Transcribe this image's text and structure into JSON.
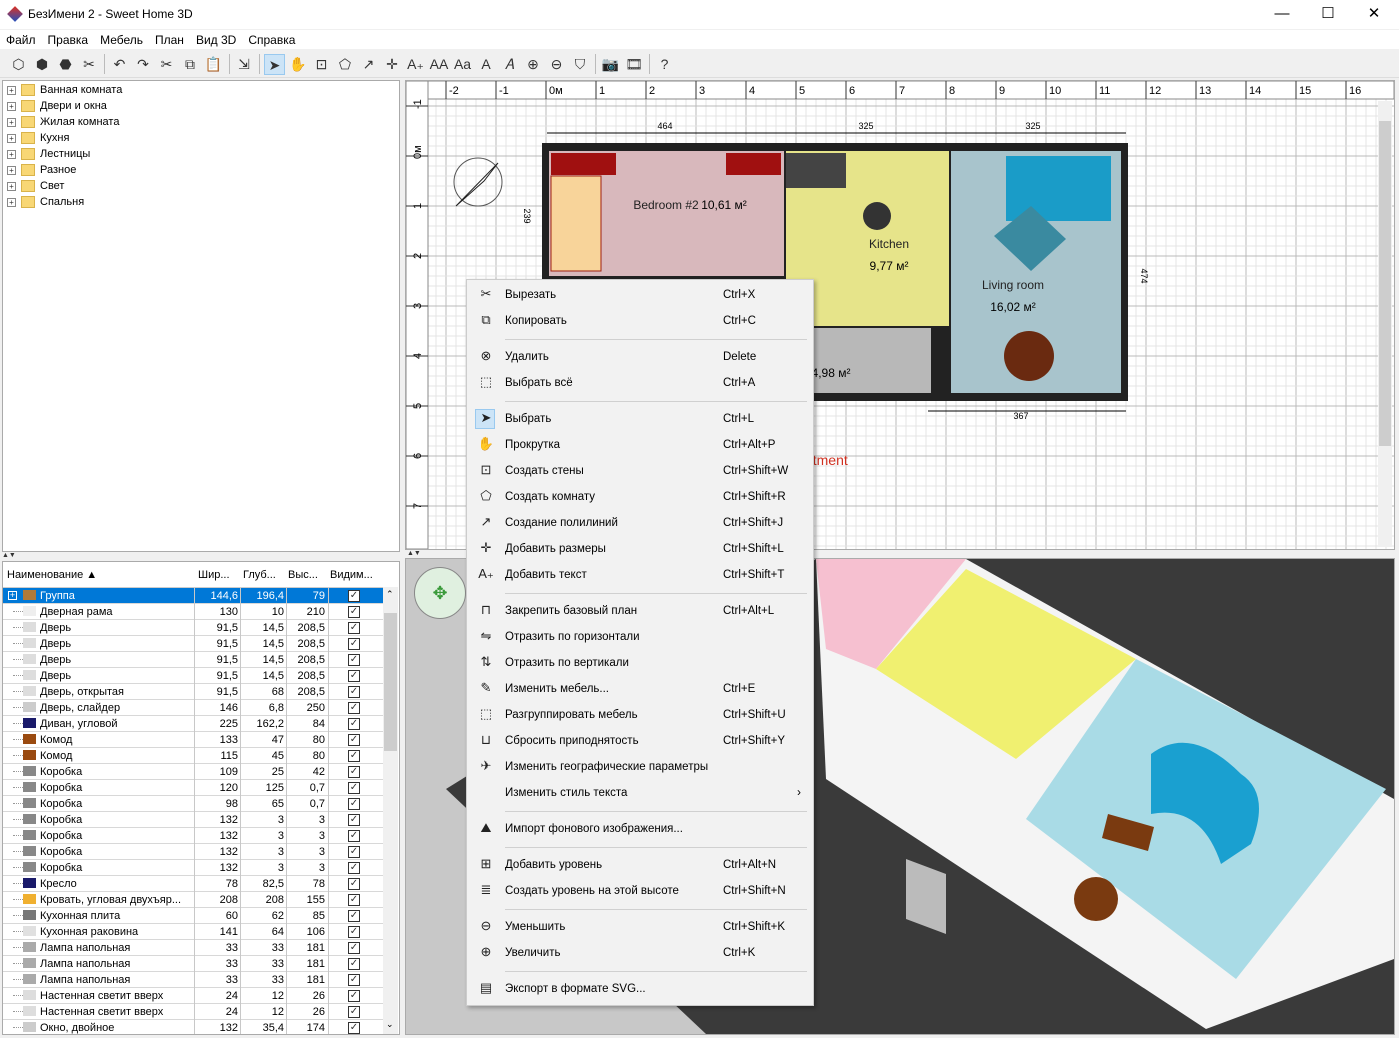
{
  "window": {
    "title": "БезИмени 2 - Sweet Home 3D",
    "minimize": "—",
    "maximize": "☐",
    "close": "✕"
  },
  "menu": [
    "Файл",
    "Правка",
    "Мебель",
    "План",
    "Вид 3D",
    "Справка"
  ],
  "toolbar": [
    {
      "name": "new-home-icon",
      "g": "⬡"
    },
    {
      "name": "open-icon",
      "g": "⬢"
    },
    {
      "name": "save-icon",
      "g": "⬣"
    },
    {
      "name": "preferences-icon",
      "g": "✂"
    },
    {
      "sep": true
    },
    {
      "name": "undo-icon",
      "g": "↶"
    },
    {
      "name": "redo-icon",
      "g": "↷"
    },
    {
      "name": "cut-icon",
      "g": "✂"
    },
    {
      "name": "copy-icon",
      "g": "⧉"
    },
    {
      "name": "paste-icon",
      "g": "📋"
    },
    {
      "sep": true
    },
    {
      "name": "add-furniture-icon",
      "g": "⇲"
    },
    {
      "sep": true
    },
    {
      "name": "select-mode-icon",
      "g": "➤",
      "on": true
    },
    {
      "name": "pan-mode-icon",
      "g": "✋"
    },
    {
      "name": "create-walls-icon",
      "g": "⊡"
    },
    {
      "name": "create-rooms-icon",
      "g": "⬠"
    },
    {
      "name": "create-polylines-icon",
      "g": "↗"
    },
    {
      "name": "create-dimensions-icon",
      "g": "✛"
    },
    {
      "name": "add-text-icon",
      "g": "A₊"
    },
    {
      "name": "increase-text-icon",
      "g": "AA"
    },
    {
      "name": "decrease-text-icon",
      "g": "Aa"
    },
    {
      "name": "bold-text-icon",
      "g": "A"
    },
    {
      "name": "italic-text-icon",
      "g": "𝐴"
    },
    {
      "name": "zoom-in-icon",
      "g": "⊕"
    },
    {
      "name": "zoom-out-icon",
      "g": "⊖"
    },
    {
      "name": "create-photo-icon",
      "g": "⛉"
    },
    {
      "sep": true
    },
    {
      "name": "photo-icon",
      "g": "📷"
    },
    {
      "name": "video-icon",
      "g": "🎞"
    },
    {
      "sep": true
    },
    {
      "name": "help-icon",
      "g": "?"
    }
  ],
  "catalog": [
    "Ванная комната",
    "Двери и окна",
    "Жилая комната",
    "Кухня",
    "Лестницы",
    "Разное",
    "Свет",
    "Спальня"
  ],
  "furniture": {
    "columns": [
      "Наименование ▲",
      "Шир...",
      "Глуб...",
      "Выс...",
      "Видим..."
    ],
    "rows": [
      [
        "Группа",
        "144,6",
        "196,4",
        "79",
        "#b07a3a"
      ],
      [
        "Дверная рама",
        "130",
        "10",
        "210",
        "#eee"
      ],
      [
        "Дверь",
        "91,5",
        "14,5",
        "208,5",
        "#ddd"
      ],
      [
        "Дверь",
        "91,5",
        "14,5",
        "208,5",
        "#ddd"
      ],
      [
        "Дверь",
        "91,5",
        "14,5",
        "208,5",
        "#ddd"
      ],
      [
        "Дверь",
        "91,5",
        "14,5",
        "208,5",
        "#ddd"
      ],
      [
        "Дверь, открытая",
        "91,5",
        "68",
        "208,5",
        "#ddd"
      ],
      [
        "Дверь, слайдер",
        "146",
        "6,8",
        "250",
        "#ccc"
      ],
      [
        "Диван, угловой",
        "225",
        "162,2",
        "84",
        "#1a1a6a"
      ],
      [
        "Комод",
        "133",
        "47",
        "80",
        "#9a4a10"
      ],
      [
        "Комод",
        "115",
        "45",
        "80",
        "#9a4a10"
      ],
      [
        "Коробка",
        "109",
        "25",
        "42",
        "#888"
      ],
      [
        "Коробка",
        "120",
        "125",
        "0,7",
        "#888"
      ],
      [
        "Коробка",
        "98",
        "65",
        "0,7",
        "#888"
      ],
      [
        "Коробка",
        "132",
        "3",
        "3",
        "#888"
      ],
      [
        "Коробка",
        "132",
        "3",
        "3",
        "#888"
      ],
      [
        "Коробка",
        "132",
        "3",
        "3",
        "#888"
      ],
      [
        "Коробка",
        "132",
        "3",
        "3",
        "#888"
      ],
      [
        "Кресло",
        "78",
        "82,5",
        "78",
        "#1a1a6a"
      ],
      [
        "Кровать, угловая двухъяр...",
        "208",
        "208",
        "155",
        "#f0b030"
      ],
      [
        "Кухонная плита",
        "60",
        "62",
        "85",
        "#777"
      ],
      [
        "Кухонная раковина",
        "141",
        "64",
        "106",
        "#e0e0e0"
      ],
      [
        "Лампа напольная",
        "33",
        "33",
        "181",
        "#aaa"
      ],
      [
        "Лампа напольная",
        "33",
        "33",
        "181",
        "#aaa"
      ],
      [
        "Лампа напольная",
        "33",
        "33",
        "181",
        "#aaa"
      ],
      [
        "Настенная светит вверх",
        "24",
        "12",
        "26",
        "#ddd"
      ],
      [
        "Настенная светит вверх",
        "24",
        "12",
        "26",
        "#ddd"
      ],
      [
        "Окно, двойное",
        "132",
        "35,4",
        "174",
        "#ccc"
      ]
    ],
    "visible_check": "✓"
  },
  "plan": {
    "ruler_x": [
      "-2",
      "-1",
      "0м",
      "1",
      "2",
      "3",
      "4",
      "5",
      "6",
      "7",
      "8",
      "9",
      "10",
      "11",
      "12",
      "13",
      "14",
      "15",
      "16"
    ],
    "ruler_y": [
      "-1",
      "0м",
      "1",
      "2",
      "3",
      "4",
      "5",
      "6",
      "7"
    ],
    "dims": [
      "464",
      "325",
      "325",
      "239",
      "474",
      "367"
    ],
    "rooms": [
      {
        "name": "Bedroom #2",
        "area": "10,61 м²"
      },
      {
        "name": "Kitchen",
        "area": "9,77 м²"
      },
      {
        "name": "Living room",
        "area": "16,02 м²"
      },
      {
        "name": "",
        "area": "4,98 м²"
      }
    ],
    "label": "Two bedroom apartment",
    "label_color": "#d03020"
  },
  "context_menu": [
    {
      "icon": "cut-icon",
      "g": "✂",
      "label": "Вырезать",
      "shortcut": "Ctrl+X"
    },
    {
      "icon": "copy-icon",
      "g": "⧉",
      "label": "Копировать",
      "shortcut": "Ctrl+C",
      "sep": true
    },
    {
      "icon": "delete-icon",
      "g": "⊗",
      "label": "Удалить",
      "shortcut": "Delete"
    },
    {
      "icon": "select-all-icon",
      "g": "⬚",
      "label": "Выбрать всё",
      "shortcut": "Ctrl+A",
      "sep": true
    },
    {
      "icon": "select-icon",
      "g": "➤",
      "label": "Выбрать",
      "shortcut": "Ctrl+L",
      "selected": true
    },
    {
      "icon": "pan-icon",
      "g": "✋",
      "label": "Прокрутка",
      "shortcut": "Ctrl+Alt+P"
    },
    {
      "icon": "create-walls-icon",
      "g": "⊡",
      "label": "Создать стены",
      "shortcut": "Ctrl+Shift+W"
    },
    {
      "icon": "create-rooms-icon",
      "g": "⬠",
      "label": "Создать комнату",
      "shortcut": "Ctrl+Shift+R"
    },
    {
      "icon": "create-polylines-icon",
      "g": "↗",
      "label": "Создание полилиний",
      "shortcut": "Ctrl+Shift+J"
    },
    {
      "icon": "create-dimensions-icon",
      "g": "✛",
      "label": "Добавить размеры",
      "shortcut": "Ctrl+Shift+L"
    },
    {
      "icon": "add-text-icon",
      "g": "A₊",
      "label": "Добавить текст",
      "shortcut": "Ctrl+Shift+T",
      "sep": true
    },
    {
      "icon": "lock-plan-icon",
      "g": "⊓",
      "label": "Закрепить базовый план",
      "shortcut": "Ctrl+Alt+L"
    },
    {
      "icon": "flip-horizontal-icon",
      "g": "⇋",
      "label": "Отразить по горизонтали",
      "shortcut": ""
    },
    {
      "icon": "flip-vertical-icon",
      "g": "⇅",
      "label": "Отразить по вертикали",
      "shortcut": ""
    },
    {
      "icon": "modify-furniture-icon",
      "g": "✎",
      "label": "Изменить мебель...",
      "shortcut": "Ctrl+E"
    },
    {
      "icon": "ungroup-icon",
      "g": "⬚",
      "label": "Разгруппировать мебель",
      "shortcut": "Ctrl+Shift+U"
    },
    {
      "icon": "reset-elevation-icon",
      "g": "⊔",
      "label": "Сбросить приподнятость",
      "shortcut": "Ctrl+Shift+Y"
    },
    {
      "icon": "compass-icon",
      "g": "✈",
      "label": "Изменить географические параметры",
      "shortcut": ""
    },
    {
      "icon": "",
      "g": "",
      "label": "Изменить стиль текста",
      "shortcut": "",
      "submenu": "›",
      "sep": true
    },
    {
      "icon": "import-background-icon",
      "g": "⛰",
      "label": "Импорт фонового изображения...",
      "shortcut": "",
      "sep": true
    },
    {
      "icon": "add-level-icon",
      "g": "⊞",
      "label": "Добавить уровень",
      "shortcut": "Ctrl+Alt+N"
    },
    {
      "icon": "add-level-same-elevation-icon",
      "g": "≣",
      "label": "Создать уровень на этой высоте",
      "shortcut": "Ctrl+Shift+N",
      "sep": true
    },
    {
      "icon": "zoom-out-icon",
      "g": "⊖",
      "label": "Уменьшить",
      "shortcut": "Ctrl+Shift+K"
    },
    {
      "icon": "zoom-in-icon",
      "g": "⊕",
      "label": "Увеличить",
      "shortcut": "Ctrl+K",
      "sep": true
    },
    {
      "icon": "export-svg-icon",
      "g": "▤",
      "label": "Экспорт в формате SVG...",
      "shortcut": ""
    }
  ]
}
